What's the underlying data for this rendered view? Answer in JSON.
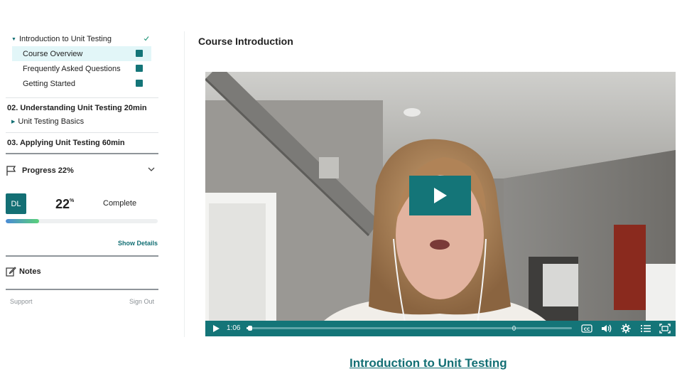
{
  "sidebar": {
    "section_title": "Introduction to Unit Testing",
    "lessons": [
      {
        "label": "Course Overview",
        "active": true
      },
      {
        "label": "Frequently Asked Questions",
        "active": false
      },
      {
        "label": "Getting Started",
        "active": false
      }
    ],
    "modules": [
      {
        "label": "02. Understanding Unit Testing 20min",
        "sublesson": "Unit Testing Basics"
      },
      {
        "label": "03. Applying Unit Testing 60min"
      }
    ],
    "progress": {
      "title": "Progress 22%",
      "avatar_initials": "DL",
      "percent": "22",
      "percent_sign": "%",
      "status": "Complete",
      "fraction": 0.22,
      "show_details": "Show Details"
    },
    "notes_label": "Notes",
    "footer": {
      "support": "Support",
      "sign_out": "Sign Out"
    }
  },
  "main": {
    "title": "Course Introduction",
    "video": {
      "current_time": "1:06",
      "played_fraction": 0.005,
      "controls": [
        "play-icon",
        "captions-icon",
        "volume-icon",
        "settings-icon",
        "chapters-icon",
        "fullscreen-icon"
      ]
    },
    "video_link": "Introduction to Unit Testing"
  },
  "colors": {
    "accent": "#136f74",
    "active_lesson_bg": "#e2f6f8",
    "progress_gradient": [
      "#4a8bd6",
      "#5ad07a"
    ]
  }
}
